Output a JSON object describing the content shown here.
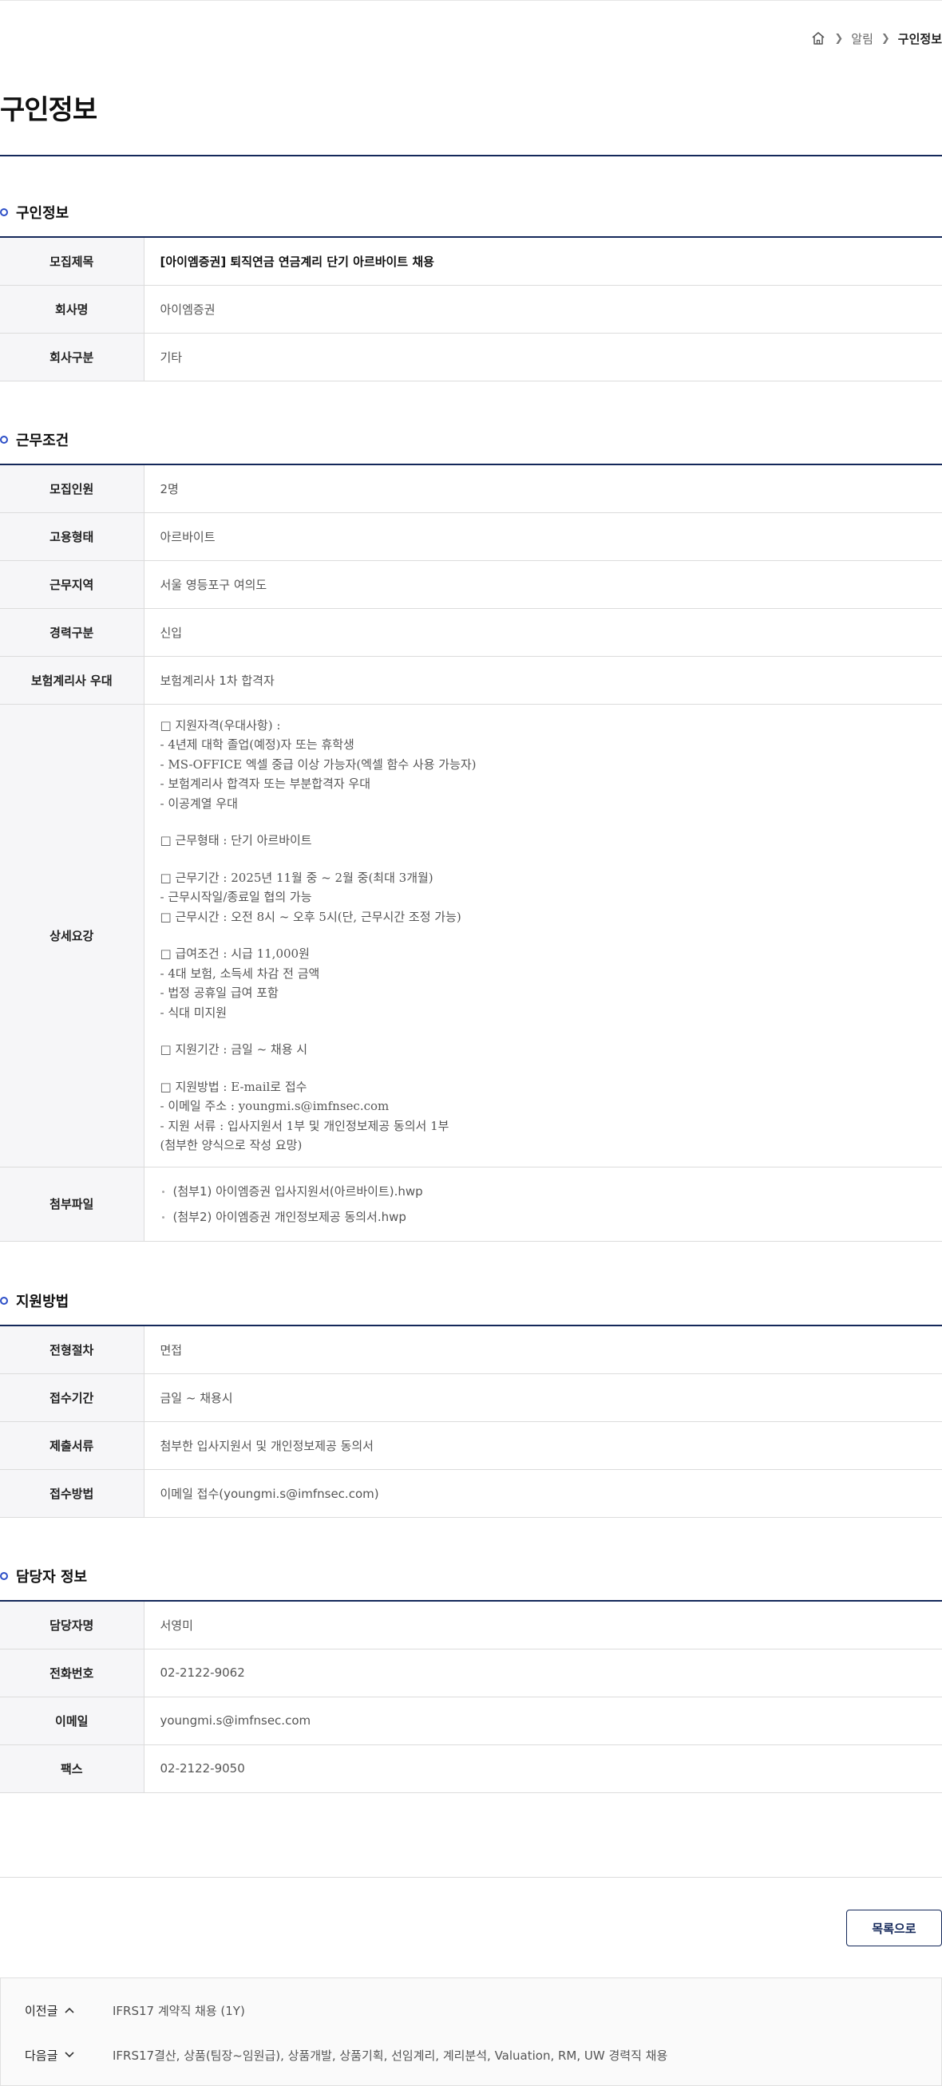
{
  "breadcrumb": {
    "items": [
      "알림",
      "구인정보"
    ]
  },
  "page_title": "구인정보",
  "sections": {
    "job_info": {
      "title": "구인정보",
      "rows": [
        {
          "label": "모집제목",
          "value": "[아이엠증권] 퇴직연금 연금계리 단기 아르바이트 채용"
        },
        {
          "label": "회사명",
          "value": "아이엠증권"
        },
        {
          "label": "회사구분",
          "value": "기타"
        }
      ]
    },
    "conditions": {
      "title": "근무조건",
      "rows": [
        {
          "label": "모집인원",
          "value": "2명"
        },
        {
          "label": "고용형태",
          "value": "아르바이트"
        },
        {
          "label": "근무지역",
          "value": "서울 영등포구 여의도"
        },
        {
          "label": "경력구분",
          "value": "신입"
        },
        {
          "label": "보험계리사 우대",
          "value": "보험계리사 1차 합격자"
        }
      ],
      "detail_label": "상세요강",
      "detail_lines": [
        "□ 지원자격(우대사항) :",
        "- 4년제 대학 졸업(예정)자 또는 휴학생",
        "- MS-OFFICE 엑셀 중급 이상 가능자(엑셀 함수 사용 가능자)",
        "- 보험계리사 합격자 또는 부분합격자 우대",
        "- 이공계열 우대",
        "",
        "□ 근무형태 : 단기 아르바이트",
        "",
        "□ 근무기간 : 2025년 11월 중 ~ 2월 중(최대 3개월)",
        "- 근무시작일/종료일 협의 가능",
        "□ 근무시간 : 오전 8시 ~ 오후 5시(단, 근무시간 조정 가능)",
        "",
        "□ 급여조건 : 시급 11,000원",
        "- 4대 보험, 소득세 차감 전 금액",
        "- 법정 공휴일 급여 포함",
        "- 식대 미지원",
        "",
        "□ 지원기간 : 금일 ~ 채용 시",
        "",
        "□ 지원방법 : E-mail로 접수",
        "- 이메일 주소 : youngmi.s@imfnsec.com",
        "- 지원 서류 : 입사지원서 1부 및 개인정보제공 동의서 1부",
        "(첨부한 양식으로 작성 요망)"
      ],
      "files_label": "첨부파일",
      "files": [
        "(첨부1) 아이엠증권 입사지원서(아르바이트).hwp",
        "(첨부2) 아이엠증권 개인정보제공 동의서.hwp"
      ]
    },
    "apply": {
      "title": "지원방법",
      "rows": [
        {
          "label": "전형절차",
          "value": "면접"
        },
        {
          "label": "접수기간",
          "value": "금일 ~ 채용시"
        },
        {
          "label": "제출서류",
          "value": "첨부한 입사지원서 및 개인정보제공 동의서"
        },
        {
          "label": "접수방법",
          "value": "이메일 접수(youngmi.s@imfnsec.com)"
        }
      ]
    },
    "contact": {
      "title": "담당자 정보",
      "rows": [
        {
          "label": "담당자명",
          "value": "서영미"
        },
        {
          "label": "전화번호",
          "value": "02-2122-9062"
        },
        {
          "label": "이메일",
          "value": "youngmi.s@imfnsec.com"
        },
        {
          "label": "팩스",
          "value": "02-2122-9050"
        }
      ]
    }
  },
  "list_button": "목록으로",
  "prev": {
    "label": "이전글",
    "title": "IFRS17 계약직 채용 (1Y)"
  },
  "next": {
    "label": "다음글",
    "title": "IFRS17결산, 상품(팀장~임원급), 상품개발, 상품기획, 선임계리, 계리분석, Valuation, RM, UW 경력직 채용"
  },
  "icons": {
    "home": "home-icon",
    "sep": "chevron-right-icon",
    "bullet": "circle-bullet-icon",
    "prev": "chevron-up-icon",
    "next": "chevron-down-icon"
  },
  "colors": {
    "accent": "#14285a",
    "bullet": "#2d4fc7",
    "header_bg": "#f6f6f8"
  }
}
